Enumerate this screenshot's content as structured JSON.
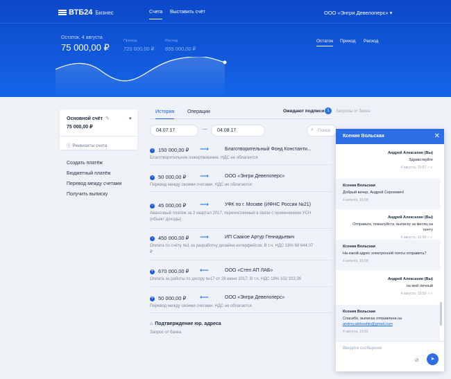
{
  "header": {
    "brand": "ВТБ24",
    "brand_sub": "Бизнес",
    "nav": [
      "Счета",
      "Выставить счёт"
    ],
    "org": "ООО «Энгри Девелоперс»"
  },
  "summary": {
    "balance_label": "Остаток, 4 августа",
    "balance": "75 000,00 ₽",
    "income_label": "Приход",
    "income": "720 000,00 ₽",
    "expense_label": "Расход",
    "expense": "695 000,00 ₽",
    "tabs": [
      "Остаток",
      "Приход",
      "Расход"
    ]
  },
  "account": {
    "name": "Основной счёт",
    "amount": "75 000,00 ₽",
    "requisites": "Реквизиты счета"
  },
  "actions": [
    "Создать платёж",
    "Бюджетный платёж",
    "Перевод между счетами",
    "Получить выписку"
  ],
  "tabs": {
    "history": "История",
    "operations": "Операции",
    "pending": "Ожидают подписи",
    "pending_count": "1",
    "bank_requests": "Запросы от банка"
  },
  "filters": {
    "date_from": "04.07.17",
    "date_to": "04.08.17",
    "search_placeholder": "Поиск"
  },
  "transactions": [
    {
      "amount": "150 000,00 ₽",
      "dir": "out",
      "counterparty": "Благотворительный Фонд Константи...",
      "desc": "Благотворительное пожертвование. НДС не облагается"
    },
    {
      "amount": "50 000,00 ₽",
      "dir": "out",
      "counterparty": "ООО «Энгри Девелоперс»",
      "desc": "Перевод между своими счетами. НДС не облагается"
    },
    {
      "amount": "45 000,00 ₽",
      "dir": "out",
      "counterparty": "УФК по г. Москве (ИФНС России №21)",
      "desc": "Авансовый платеж за 2 квартал 2017, перечисляемый в связи с применением УСН (объект доходы)"
    },
    {
      "amount": "450 000,00 ₽",
      "dir": "out",
      "counterparty": "ИП Саакое Артур Геннадьевич",
      "desc": "Оплата по счёту №1 за разработку дизайна интерфейсов. В т.ч. НДС 18% 68 644,07 ₽"
    },
    {
      "amount": "670 000,00 ₽",
      "dir": "in",
      "counterparty": "ООО «Степ АП ЛАБ»",
      "desc": "Оплата за работы по догору №17 от 28 июня 2017. В т.ч. НДС 18% 102 203,39"
    },
    {
      "amount": "50 000,00 ₽",
      "dir": "in",
      "counterparty": "ООО «Энгри Девелоперс»",
      "desc": "Перевод между своими счетами. НДС не облагается"
    }
  ],
  "confirmation": {
    "title": "Подтверждение юр. адреса",
    "sub": "Запрос от банка"
  },
  "chat": {
    "title": "Ксения Вольская",
    "messages": [
      {
        "from": "Андрей Алексахин (Вы)",
        "text": "Здравствуйте",
        "time": "4 августа, 15:57",
        "out": true
      },
      {
        "from": "Ксения Вольская",
        "text": "Добрый вечер, Андрей Сергеевич!",
        "time": "4 августа, 15:58",
        "out": false
      },
      {
        "from": "Андрей Алексахин (Вы)",
        "text": "Отправьте, пожалуйста, выписку за месяц на почту",
        "time": "4 августа, 15:58",
        "out": true
      },
      {
        "from": "Ксения Вольская",
        "text": "На какой адрес электронной почты отправить?",
        "time": "4 августа, 15:58",
        "out": false
      },
      {
        "from": "Андрей Алексахин (Вы)",
        "text": "на мой личный",
        "time": "4 августа, 15:59",
        "out": true
      },
      {
        "from": "Ксения Вольская",
        "text": "Спасибо, выписка отправлена на",
        "link": "andrey.aleksahin@gmail.com",
        "time": "4 августа, 15:01",
        "out": false
      }
    ],
    "input_placeholder": "Введите сообщение"
  },
  "colors": {
    "brand": "#1565e8",
    "hero_top": "#0c47c9"
  }
}
